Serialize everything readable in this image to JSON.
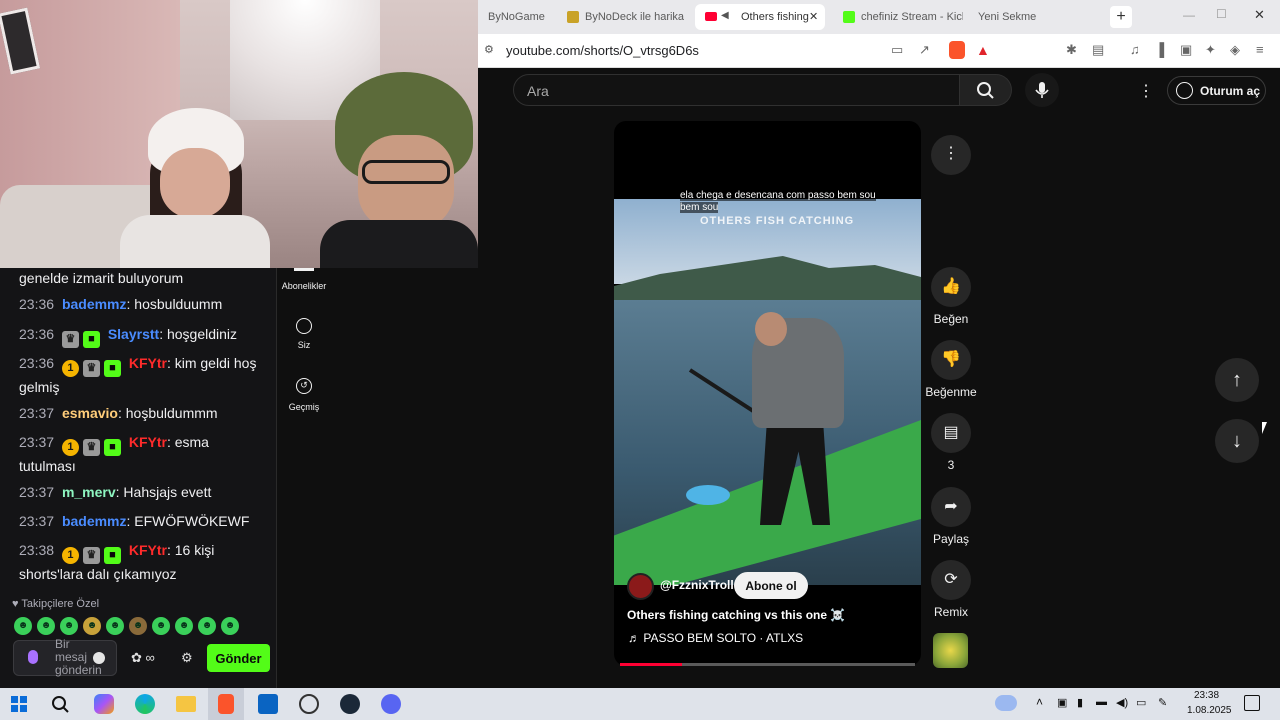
{
  "browser": {
    "tabs": [
      {
        "label": "ByNoGame",
        "active": false
      },
      {
        "label": "ByNoDeck ile harika k",
        "active": false
      },
      {
        "label": "Others fishing",
        "active": true
      },
      {
        "label": "chefiniz Stream - Kick",
        "active": false
      },
      {
        "label": "Yeni Sekme",
        "active": false
      }
    ],
    "url": "youtube.com/shorts/O_vtrsg6D6s"
  },
  "youtube": {
    "search_placeholder": "Ara",
    "signin_label": "Oturum aç",
    "nav": [
      {
        "label": "Abonelikler"
      },
      {
        "label": "Siz"
      },
      {
        "label": "Geçmiş"
      }
    ],
    "video": {
      "caption": "ela chega e desencana com passo bem sou bem sou",
      "overlay_title": "OTHERS FISH CATCHING",
      "channel": "@FzznixTroll",
      "subscribe_label": "Abone ol",
      "title": "Others fishing catching vs this one ☠️",
      "sound": "PASSO BEM SOLTO · ATLXS",
      "progress_fraction": 0.21
    },
    "actions": {
      "like_label": "Beğen",
      "dislike_label": "Beğenme",
      "comments_count": "3",
      "share_label": "Paylaş",
      "remix_label": "Remix"
    }
  },
  "chat": {
    "messages": [
      {
        "time": "",
        "user": "",
        "text": "genelde izmarit buluyorum"
      },
      {
        "time": "23:36",
        "user": "bademmz",
        "text": "hosbulduumm"
      },
      {
        "time": "23:36",
        "user": "Slayrstt",
        "text": "hoşgeldiniz"
      },
      {
        "time": "23:36",
        "user": "KFYtr",
        "text": "kim geldi hoş gelmiş"
      },
      {
        "time": "23:37",
        "user": "esmavio",
        "text": "hoşbuldummm"
      },
      {
        "time": "23:37",
        "user": "KFYtr",
        "text": "esma tutulması"
      },
      {
        "time": "23:37",
        "user": "m_merv",
        "text": "Hahsjajs evett"
      },
      {
        "time": "23:37",
        "user": "bademmz",
        "text": "EFWÖFWÖKEWF"
      },
      {
        "time": "23:38",
        "user": "KFYtr",
        "text": "16 kişi shorts'lara dalı çıkamıyoz"
      }
    ],
    "badge_one": "1",
    "followers_label": "Takipçilere Özel",
    "input_placeholder": "Bir mesaj gönderin",
    "extra_label": "∞",
    "send_label": "Gönder"
  },
  "taskbar": {
    "time": "23:38",
    "date": "1.08.2025"
  },
  "colors": {
    "kick_green": "#53fc18",
    "yt_red": "#ff0033",
    "user_blue": "#4a8cff",
    "user_red": "#ff2b2b"
  }
}
